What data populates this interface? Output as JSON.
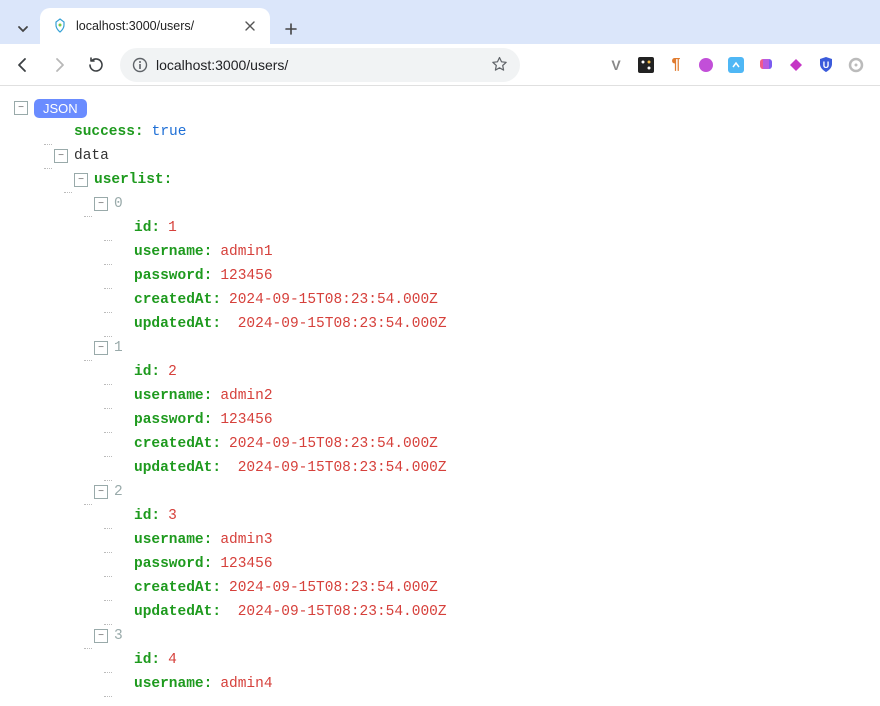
{
  "browser": {
    "tab_title": "localhost:3000/users/",
    "url_display": "localhost:3000/users/",
    "extensions": [
      "v",
      "dice",
      "para",
      "circle1",
      "circle2",
      "brain",
      "kite",
      "shield",
      "ring"
    ]
  },
  "json_root_label": "JSON",
  "tree": {
    "success_key": "success",
    "success_val": "true",
    "data_key": "data",
    "userlist_key": "userlist",
    "indices": [
      "0",
      "1",
      "2",
      "3"
    ],
    "field_id": "id",
    "field_username": "username",
    "field_password": "password",
    "field_createdAt": "createdAt",
    "field_updatedAt": "updatedAt",
    "rows": [
      {
        "id": "1",
        "username": "admin1",
        "password": "123456",
        "createdAt": "2024-09-15T08:23:54.000Z",
        "updatedAt": "2024-09-15T08:23:54.000Z"
      },
      {
        "id": "2",
        "username": "admin2",
        "password": "123456",
        "createdAt": "2024-09-15T08:23:54.000Z",
        "updatedAt": "2024-09-15T08:23:54.000Z"
      },
      {
        "id": "3",
        "username": "admin3",
        "password": "123456",
        "createdAt": "2024-09-15T08:23:54.000Z",
        "updatedAt": "2024-09-15T08:23:54.000Z"
      },
      {
        "id": "4",
        "username": "admin4"
      }
    ]
  }
}
